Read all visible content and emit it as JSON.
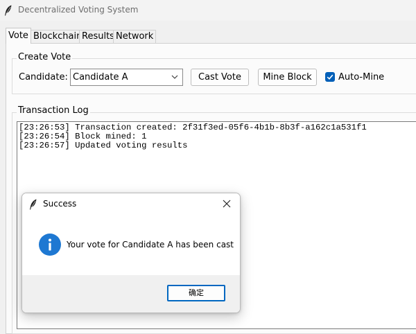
{
  "window": {
    "title": "Decentralized Voting System",
    "icon": "feather-icon"
  },
  "tabs": [
    "Vote",
    "Blockchain",
    "Results",
    "Network"
  ],
  "active_tab": "Vote",
  "create_vote": {
    "group_label": "Create Vote",
    "candidate_label": "Candidate:",
    "candidate_value": "Candidate A",
    "cast_vote_label": "Cast Vote",
    "mine_block_label": "Mine Block",
    "auto_mine_label": "Auto-Mine",
    "auto_mine_checked": true
  },
  "transaction_log": {
    "group_label": "Transaction Log",
    "lines": [
      "[23:26:53] Transaction created: 2f31f3ed-05f6-4b1b-8b3f-a162c1a531f1",
      "[23:26:54] Block mined: 1",
      "[23:26:57] Updated voting results"
    ]
  },
  "dialog": {
    "title": "Success",
    "message": "Your vote for Candidate A has been cast",
    "ok_label": "确定",
    "icon": "info-icon"
  },
  "colors": {
    "accent": "#005fb8",
    "info_icon": "#1e78d2",
    "ok_border": "#0067c0"
  }
}
